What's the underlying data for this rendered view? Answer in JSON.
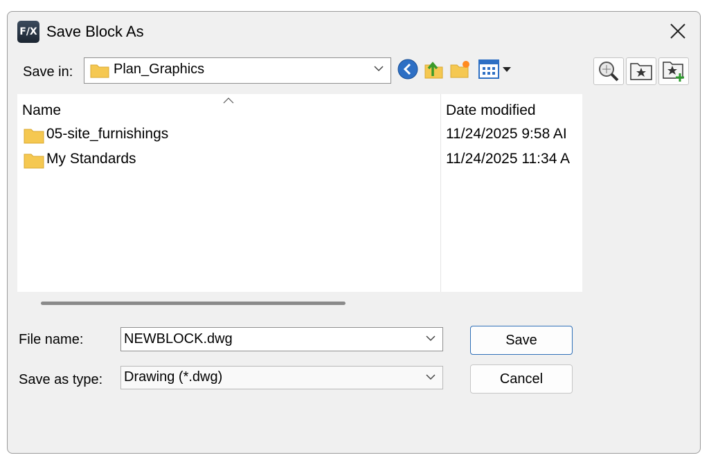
{
  "window": {
    "title": "Save Block As",
    "app_icon_text": "F/X"
  },
  "toolbar": {
    "save_in_label": "Save in:",
    "save_in_value": "Plan_Graphics",
    "icons": [
      "back-icon",
      "up-folder-icon",
      "new-folder-icon",
      "view-menu-icon",
      "search-web-icon",
      "favorites-folder-icon",
      "add-to-favorites-icon"
    ]
  },
  "filelist": {
    "columns": [
      "Name",
      "Date modified"
    ],
    "rows": [
      {
        "name": "05-site_furnishings",
        "date": "11/24/2025 9:58 AI"
      },
      {
        "name": "My Standards",
        "date": "11/24/2025 11:34 A"
      }
    ]
  },
  "form": {
    "file_name_label": "File name:",
    "file_name_value": "NEWBLOCK.dwg",
    "save_as_type_label": "Save as type:",
    "save_as_type_value": "Drawing (*.dwg)"
  },
  "buttons": {
    "save": "Save",
    "cancel": "Cancel"
  },
  "colors": {
    "dialog_bg": "#f0f0f0",
    "folder": "#f5c851",
    "accent": "#2f6fb8"
  }
}
